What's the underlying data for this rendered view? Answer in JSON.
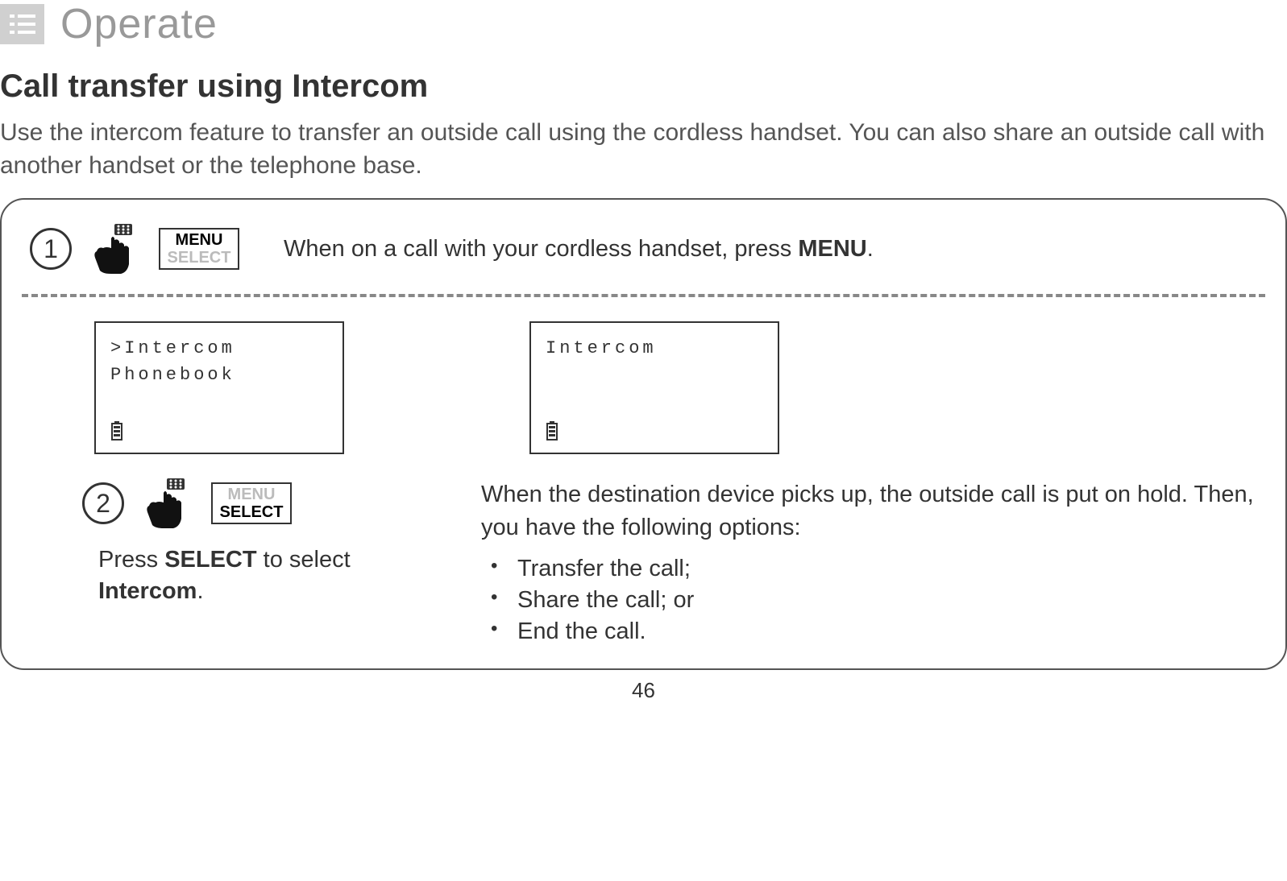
{
  "header": {
    "section": "Operate"
  },
  "heading": "Call transfer using Intercom",
  "intro": "Use the intercom feature to transfer an outside call using the cordless handset. You can also share an outside call with another handset or the telephone base.",
  "step1": {
    "number": "1",
    "menuLabel": "MENU",
    "selectLabel": "SELECT",
    "text_before": "When on a call with your cordless handset, press ",
    "text_bold": "MENU",
    "text_after": "."
  },
  "step2": {
    "number": "2",
    "menuLabel": "MENU",
    "selectLabel": "SELECT",
    "screen_line1": ">Intercom",
    "screen_line2": " Phonebook",
    "text_before": "Press ",
    "text_bold1": "SELECT",
    "text_mid": " to select ",
    "text_bold2": "Intercom",
    "text_after": "."
  },
  "right": {
    "screen_line1": "Intercom",
    "intro": "When the destination device picks up, the outside call is put on hold. Then, you have the following options:",
    "options": [
      "Transfer the call;",
      "Share the call; or",
      "End the call."
    ]
  },
  "pageNumber": "46"
}
